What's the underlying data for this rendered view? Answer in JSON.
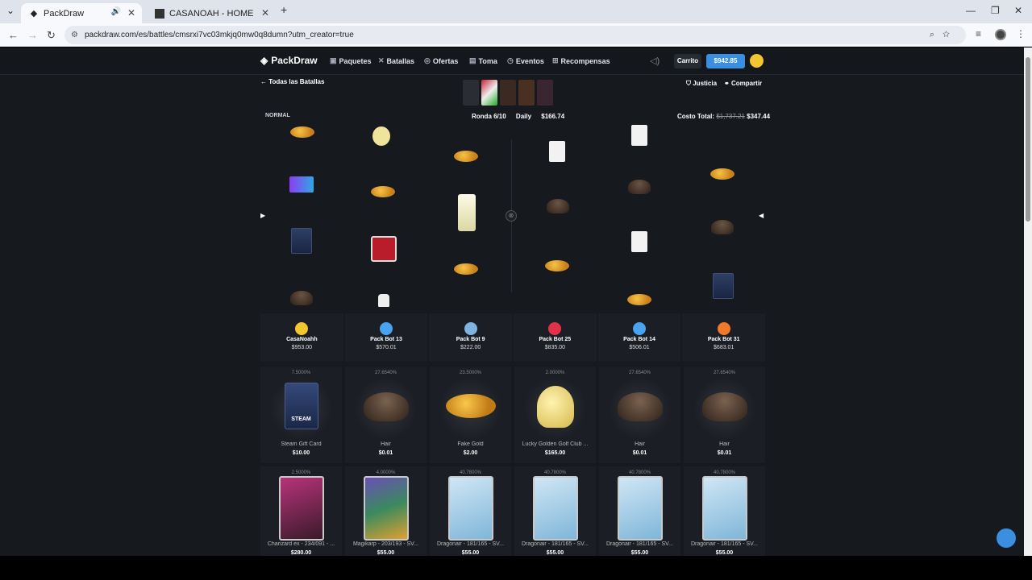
{
  "browser": {
    "tabs": [
      {
        "title": "PackDraw"
      },
      {
        "title": "CASANOAH - HOME"
      }
    ],
    "url": "packdraw.com/es/battles/cmsrxi7vc03mkjq0mw0q8dumn?utm_creator=true",
    "new_tab": "+"
  },
  "nav": {
    "logo": "PackDraw",
    "items": [
      "Paquetes",
      "Batallas",
      "Ofertas",
      "Toma",
      "Eventos",
      "Recompensas"
    ],
    "cart": "Carrito",
    "balance": "$942.85"
  },
  "battle": {
    "back": "Todas las Batallas",
    "fairness": "Justicia",
    "share": "Compartir",
    "mode": "NORMAL",
    "round": "Ronda 6/10",
    "pack_name": "Daily",
    "pack_price": "$166.74",
    "cost_label": "Costo Total:",
    "cost_old": "$1,737.21",
    "cost_new": "$347.44"
  },
  "players": [
    {
      "name": "CasaNoahh",
      "value": "$953.00",
      "color": "#f3c531"
    },
    {
      "name": "Pack Bot 13",
      "value": "$570.01",
      "color": "#4aa3f0"
    },
    {
      "name": "Pack Bot 9",
      "value": "$222.00",
      "color": "#7fb3e0"
    },
    {
      "name": "Pack Bot 25",
      "value": "$835.00",
      "color": "#e0334a"
    },
    {
      "name": "Pack Bot 14",
      "value": "$506.01",
      "color": "#4aa3f0"
    },
    {
      "name": "Pack Bot 31",
      "value": "$683.01",
      "color": "#f07a2a"
    }
  ],
  "row1": [
    {
      "pct": "7.5000%",
      "name": "Steam Gift Card",
      "price": "$10.00",
      "art": "steam",
      "art_label": "STEAM"
    },
    {
      "pct": "27.6540%",
      "name": "Hair",
      "price": "$0.01",
      "art": "hair"
    },
    {
      "pct": "23.5000%",
      "name": "Fake Gold",
      "price": "$2.00",
      "art": "gold"
    },
    {
      "pct": "2.0000%",
      "name": "Lucky Golden Golf Club ...",
      "price": "$165.00",
      "art": "club"
    },
    {
      "pct": "27.6540%",
      "name": "Hair",
      "price": "$0.01",
      "art": "hair"
    },
    {
      "pct": "27.6540%",
      "name": "Hair",
      "price": "$0.01",
      "art": "hair"
    }
  ],
  "row2": [
    {
      "pct": "2.5000%",
      "name": "Charizard ex - 234/091 - ...",
      "price": "$280.00",
      "color": "#b8337a"
    },
    {
      "pct": "4.0000%",
      "name": "Magikarp - 203/193 - SV...",
      "price": "$55.00",
      "color": "#3a8a5e"
    },
    {
      "pct": "40.7800%",
      "name": "Dragonair - 181/165 - SV...",
      "price": "$55.00",
      "color": "#7fb6d8"
    },
    {
      "pct": "40.7800%",
      "name": "Dragonair - 181/165 - SV...",
      "price": "$55.00",
      "color": "#7fb6d8"
    },
    {
      "pct": "40.7800%",
      "name": "Dragonair - 181/165 - SV...",
      "price": "$55.00",
      "color": "#7fb6d8"
    },
    {
      "pct": "40.7800%",
      "name": "Dragonair - 181/165 - SV...",
      "price": "$55.00",
      "color": "#7fb6d8"
    }
  ]
}
